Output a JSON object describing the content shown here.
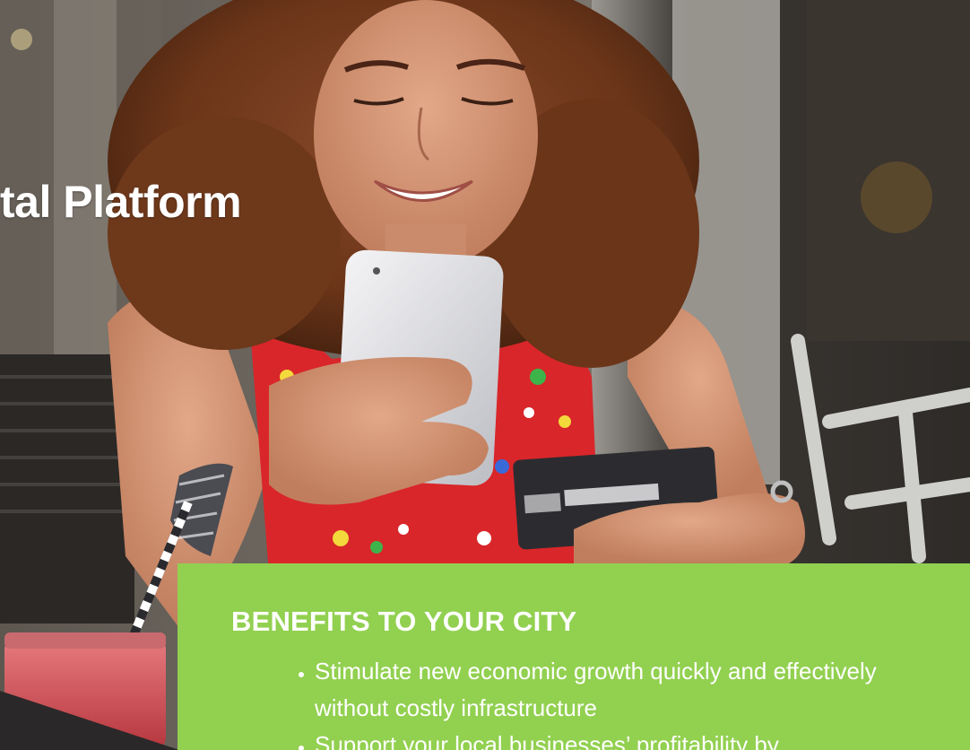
{
  "hero": {
    "title": "tal Platform"
  },
  "benefits": {
    "heading": "BENEFITS TO YOUR CITY",
    "items": [
      "Stimulate new economic growth quickly and effectively without costly infrastructure",
      "Support your local businesses’ profitability by"
    ]
  },
  "colors": {
    "panel_green": "#92d050",
    "text_white": "#ffffff",
    "dress_red": "#d9262a"
  }
}
